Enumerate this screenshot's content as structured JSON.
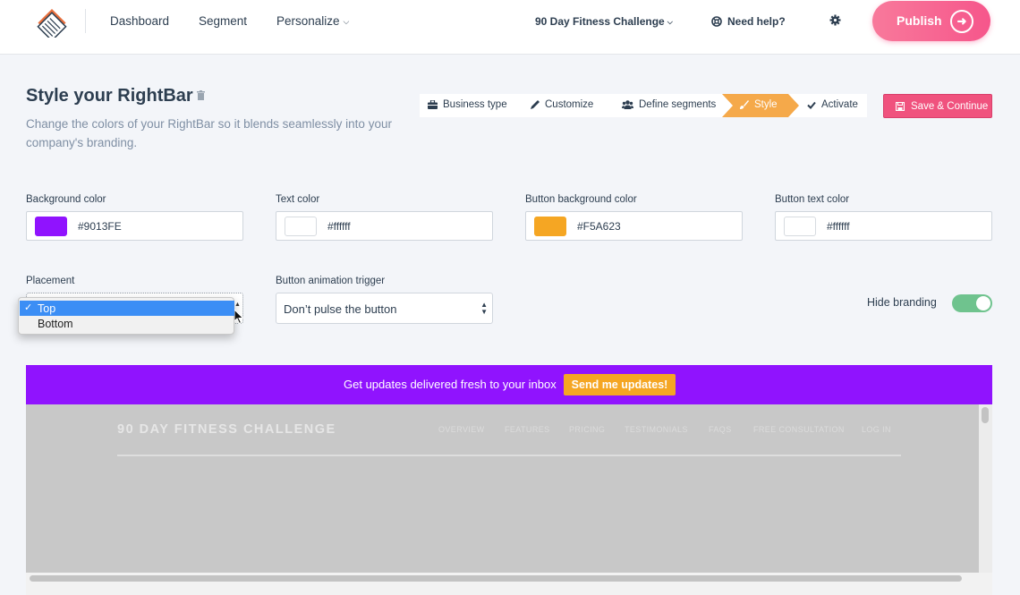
{
  "nav": {
    "dashboard": "Dashboard",
    "segment": "Segment",
    "personalize": "Personalize",
    "project": "90 Day Fitness Challenge",
    "help": "Need help?",
    "publish": "Publish"
  },
  "header": {
    "title": "Style your RightBar",
    "subtitle": "Change the colors of your RightBar so it blends seamlessly into your company's branding."
  },
  "steps": {
    "business_type": "Business type",
    "customize": "Customize",
    "define_segments": "Define segments",
    "style": "Style",
    "activate": "Activate",
    "active": "Style"
  },
  "save_button": "Save & Continue",
  "colors": {
    "background": {
      "label": "Background color",
      "value": "#9013FE"
    },
    "text": {
      "label": "Text color",
      "value": "#ffffff"
    },
    "button_bg": {
      "label": "Button background color",
      "value": "#F5A623"
    },
    "button_text": {
      "label": "Button text color",
      "value": "#ffffff"
    }
  },
  "placement": {
    "label": "Placement",
    "options": [
      "Top",
      "Bottom"
    ],
    "selected": "Top"
  },
  "animation": {
    "label": "Button animation trigger",
    "value": "Don’t pulse the button"
  },
  "hide_branding": {
    "label": "Hide branding",
    "on": true
  },
  "preview": {
    "bar_message": "Get updates delivered fresh to your inbox",
    "bar_button": "Send me updates!",
    "site_title": "90 DAY FITNESS CHALLENGE",
    "site_nav": [
      "OVERVIEW",
      "FEATURES",
      "PRICING",
      "TESTIMONIALS",
      "FAQS",
      "FREE CONSULTATION",
      "LOG IN"
    ]
  },
  "theme": {
    "publish_gradient": [
      "#f8799b",
      "#f6568b"
    ],
    "step_active": "#f5a94a",
    "save_button": "#f0527e",
    "toggle_on": "#6fc38e"
  },
  "icons": {
    "logo": "layers-logo",
    "help": "lifebuoy-icon",
    "settings": "gear-icon",
    "publish": "arrow-right-circle-icon",
    "delete": "trash-icon",
    "business_type": "briefcase-icon",
    "customize": "pencil-icon",
    "define_segments": "users-icon",
    "style": "brush-icon",
    "activate": "check-icon",
    "save": "floppy-icon"
  }
}
